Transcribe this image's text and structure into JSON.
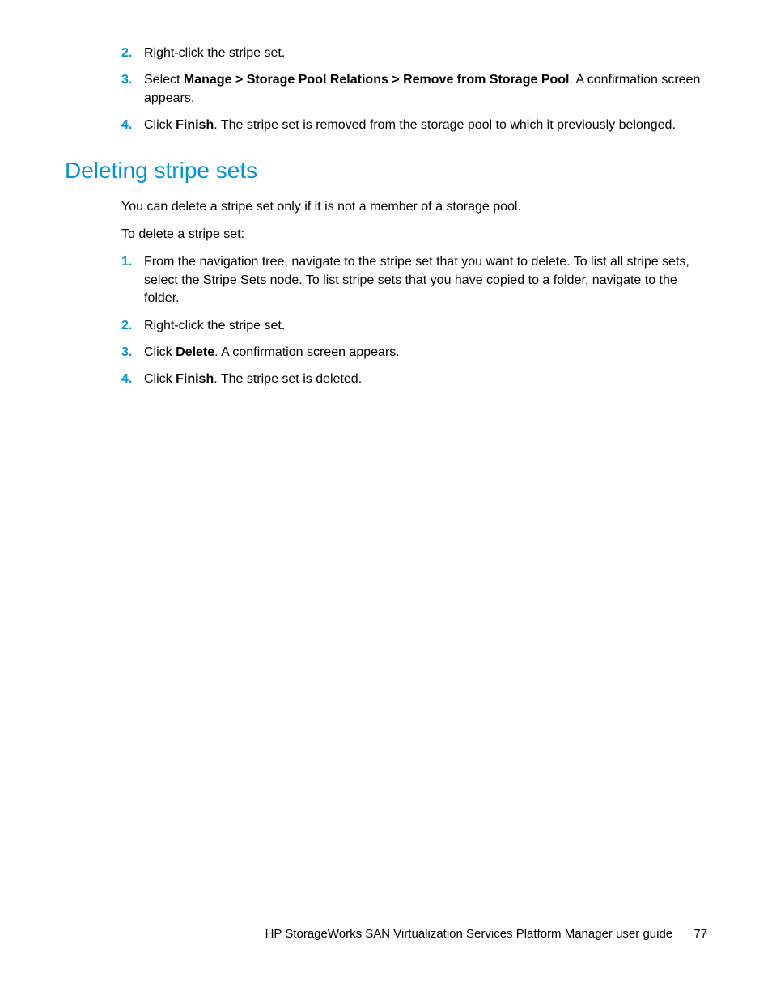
{
  "list1": {
    "items": [
      {
        "num": "2.",
        "text": "Right-click the stripe set."
      },
      {
        "num": "3.",
        "prefix": "Select ",
        "bold": "Manage > Storage Pool Relations > Remove from Storage Pool",
        "suffix": ". A confirmation screen appears."
      },
      {
        "num": "4.",
        "prefix": "Click ",
        "bold": "Finish",
        "suffix": ". The stripe set is removed from the storage pool to which it previously belonged."
      }
    ]
  },
  "heading": "Deleting stripe sets",
  "para1": "You can delete a stripe set only if it is not a member of a storage pool.",
  "para2": "To delete a stripe set:",
  "list2": {
    "items": [
      {
        "num": "1.",
        "text": "From the navigation tree, navigate to the stripe set that you want to delete. To list all stripe sets, select the Stripe Sets node. To list stripe sets that you have copied to a folder, navigate to the folder."
      },
      {
        "num": "2.",
        "text": "Right-click the stripe set."
      },
      {
        "num": "3.",
        "prefix": "Click ",
        "bold": "Delete",
        "suffix": ". A confirmation screen appears."
      },
      {
        "num": "4.",
        "prefix": "Click ",
        "bold": "Finish",
        "suffix": ". The stripe set is deleted."
      }
    ]
  },
  "footer": {
    "title": "HP StorageWorks SAN Virtualization Services Platform Manager user guide",
    "page": "77"
  }
}
